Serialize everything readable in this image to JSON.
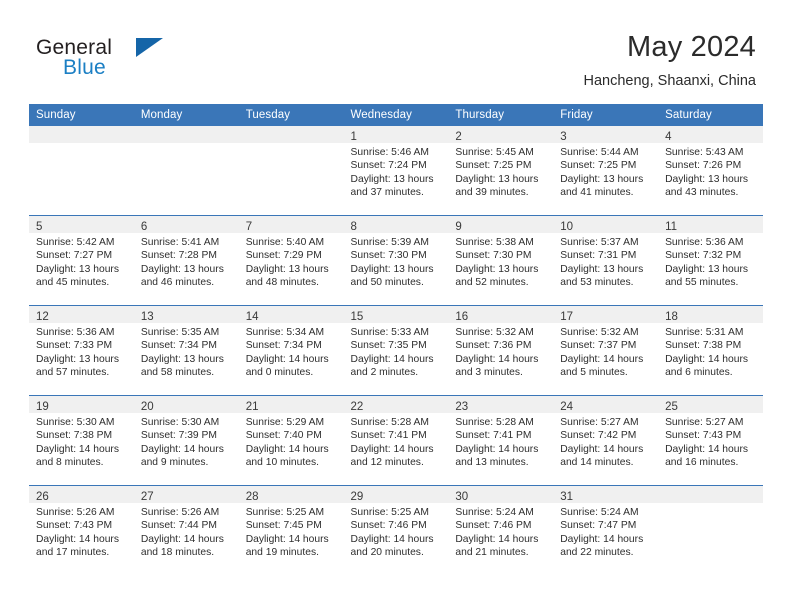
{
  "brand": {
    "name_primary": "General",
    "name_secondary": "Blue",
    "triangle_icon": "triangle-icon",
    "accent_color": "#1b7fc4"
  },
  "header": {
    "month_title": "May 2024",
    "location": "Hancheng, Shaanxi, China"
  },
  "calendar": {
    "header_color": "#3a76b8",
    "daynum_strip_color": "#f0f0f0",
    "weekday_headers": [
      "Sunday",
      "Monday",
      "Tuesday",
      "Wednesday",
      "Thursday",
      "Friday",
      "Saturday"
    ],
    "weeks": [
      [
        {
          "day": "",
          "lines": []
        },
        {
          "day": "",
          "lines": []
        },
        {
          "day": "",
          "lines": []
        },
        {
          "day": "1",
          "lines": [
            "Sunrise: 5:46 AM",
            "Sunset: 7:24 PM",
            "Daylight: 13 hours",
            "and 37 minutes."
          ]
        },
        {
          "day": "2",
          "lines": [
            "Sunrise: 5:45 AM",
            "Sunset: 7:25 PM",
            "Daylight: 13 hours",
            "and 39 minutes."
          ]
        },
        {
          "day": "3",
          "lines": [
            "Sunrise: 5:44 AM",
            "Sunset: 7:25 PM",
            "Daylight: 13 hours",
            "and 41 minutes."
          ]
        },
        {
          "day": "4",
          "lines": [
            "Sunrise: 5:43 AM",
            "Sunset: 7:26 PM",
            "Daylight: 13 hours",
            "and 43 minutes."
          ]
        }
      ],
      [
        {
          "day": "5",
          "lines": [
            "Sunrise: 5:42 AM",
            "Sunset: 7:27 PM",
            "Daylight: 13 hours",
            "and 45 minutes."
          ]
        },
        {
          "day": "6",
          "lines": [
            "Sunrise: 5:41 AM",
            "Sunset: 7:28 PM",
            "Daylight: 13 hours",
            "and 46 minutes."
          ]
        },
        {
          "day": "7",
          "lines": [
            "Sunrise: 5:40 AM",
            "Sunset: 7:29 PM",
            "Daylight: 13 hours",
            "and 48 minutes."
          ]
        },
        {
          "day": "8",
          "lines": [
            "Sunrise: 5:39 AM",
            "Sunset: 7:30 PM",
            "Daylight: 13 hours",
            "and 50 minutes."
          ]
        },
        {
          "day": "9",
          "lines": [
            "Sunrise: 5:38 AM",
            "Sunset: 7:30 PM",
            "Daylight: 13 hours",
            "and 52 minutes."
          ]
        },
        {
          "day": "10",
          "lines": [
            "Sunrise: 5:37 AM",
            "Sunset: 7:31 PM",
            "Daylight: 13 hours",
            "and 53 minutes."
          ]
        },
        {
          "day": "11",
          "lines": [
            "Sunrise: 5:36 AM",
            "Sunset: 7:32 PM",
            "Daylight: 13 hours",
            "and 55 minutes."
          ]
        }
      ],
      [
        {
          "day": "12",
          "lines": [
            "Sunrise: 5:36 AM",
            "Sunset: 7:33 PM",
            "Daylight: 13 hours",
            "and 57 minutes."
          ]
        },
        {
          "day": "13",
          "lines": [
            "Sunrise: 5:35 AM",
            "Sunset: 7:34 PM",
            "Daylight: 13 hours",
            "and 58 minutes."
          ]
        },
        {
          "day": "14",
          "lines": [
            "Sunrise: 5:34 AM",
            "Sunset: 7:34 PM",
            "Daylight: 14 hours",
            "and 0 minutes."
          ]
        },
        {
          "day": "15",
          "lines": [
            "Sunrise: 5:33 AM",
            "Sunset: 7:35 PM",
            "Daylight: 14 hours",
            "and 2 minutes."
          ]
        },
        {
          "day": "16",
          "lines": [
            "Sunrise: 5:32 AM",
            "Sunset: 7:36 PM",
            "Daylight: 14 hours",
            "and 3 minutes."
          ]
        },
        {
          "day": "17",
          "lines": [
            "Sunrise: 5:32 AM",
            "Sunset: 7:37 PM",
            "Daylight: 14 hours",
            "and 5 minutes."
          ]
        },
        {
          "day": "18",
          "lines": [
            "Sunrise: 5:31 AM",
            "Sunset: 7:38 PM",
            "Daylight: 14 hours",
            "and 6 minutes."
          ]
        }
      ],
      [
        {
          "day": "19",
          "lines": [
            "Sunrise: 5:30 AM",
            "Sunset: 7:38 PM",
            "Daylight: 14 hours",
            "and 8 minutes."
          ]
        },
        {
          "day": "20",
          "lines": [
            "Sunrise: 5:30 AM",
            "Sunset: 7:39 PM",
            "Daylight: 14 hours",
            "and 9 minutes."
          ]
        },
        {
          "day": "21",
          "lines": [
            "Sunrise: 5:29 AM",
            "Sunset: 7:40 PM",
            "Daylight: 14 hours",
            "and 10 minutes."
          ]
        },
        {
          "day": "22",
          "lines": [
            "Sunrise: 5:28 AM",
            "Sunset: 7:41 PM",
            "Daylight: 14 hours",
            "and 12 minutes."
          ]
        },
        {
          "day": "23",
          "lines": [
            "Sunrise: 5:28 AM",
            "Sunset: 7:41 PM",
            "Daylight: 14 hours",
            "and 13 minutes."
          ]
        },
        {
          "day": "24",
          "lines": [
            "Sunrise: 5:27 AM",
            "Sunset: 7:42 PM",
            "Daylight: 14 hours",
            "and 14 minutes."
          ]
        },
        {
          "day": "25",
          "lines": [
            "Sunrise: 5:27 AM",
            "Sunset: 7:43 PM",
            "Daylight: 14 hours",
            "and 16 minutes."
          ]
        }
      ],
      [
        {
          "day": "26",
          "lines": [
            "Sunrise: 5:26 AM",
            "Sunset: 7:43 PM",
            "Daylight: 14 hours",
            "and 17 minutes."
          ]
        },
        {
          "day": "27",
          "lines": [
            "Sunrise: 5:26 AM",
            "Sunset: 7:44 PM",
            "Daylight: 14 hours",
            "and 18 minutes."
          ]
        },
        {
          "day": "28",
          "lines": [
            "Sunrise: 5:25 AM",
            "Sunset: 7:45 PM",
            "Daylight: 14 hours",
            "and 19 minutes."
          ]
        },
        {
          "day": "29",
          "lines": [
            "Sunrise: 5:25 AM",
            "Sunset: 7:46 PM",
            "Daylight: 14 hours",
            "and 20 minutes."
          ]
        },
        {
          "day": "30",
          "lines": [
            "Sunrise: 5:24 AM",
            "Sunset: 7:46 PM",
            "Daylight: 14 hours",
            "and 21 minutes."
          ]
        },
        {
          "day": "31",
          "lines": [
            "Sunrise: 5:24 AM",
            "Sunset: 7:47 PM",
            "Daylight: 14 hours",
            "and 22 minutes."
          ]
        },
        {
          "day": "",
          "lines": []
        }
      ]
    ]
  }
}
